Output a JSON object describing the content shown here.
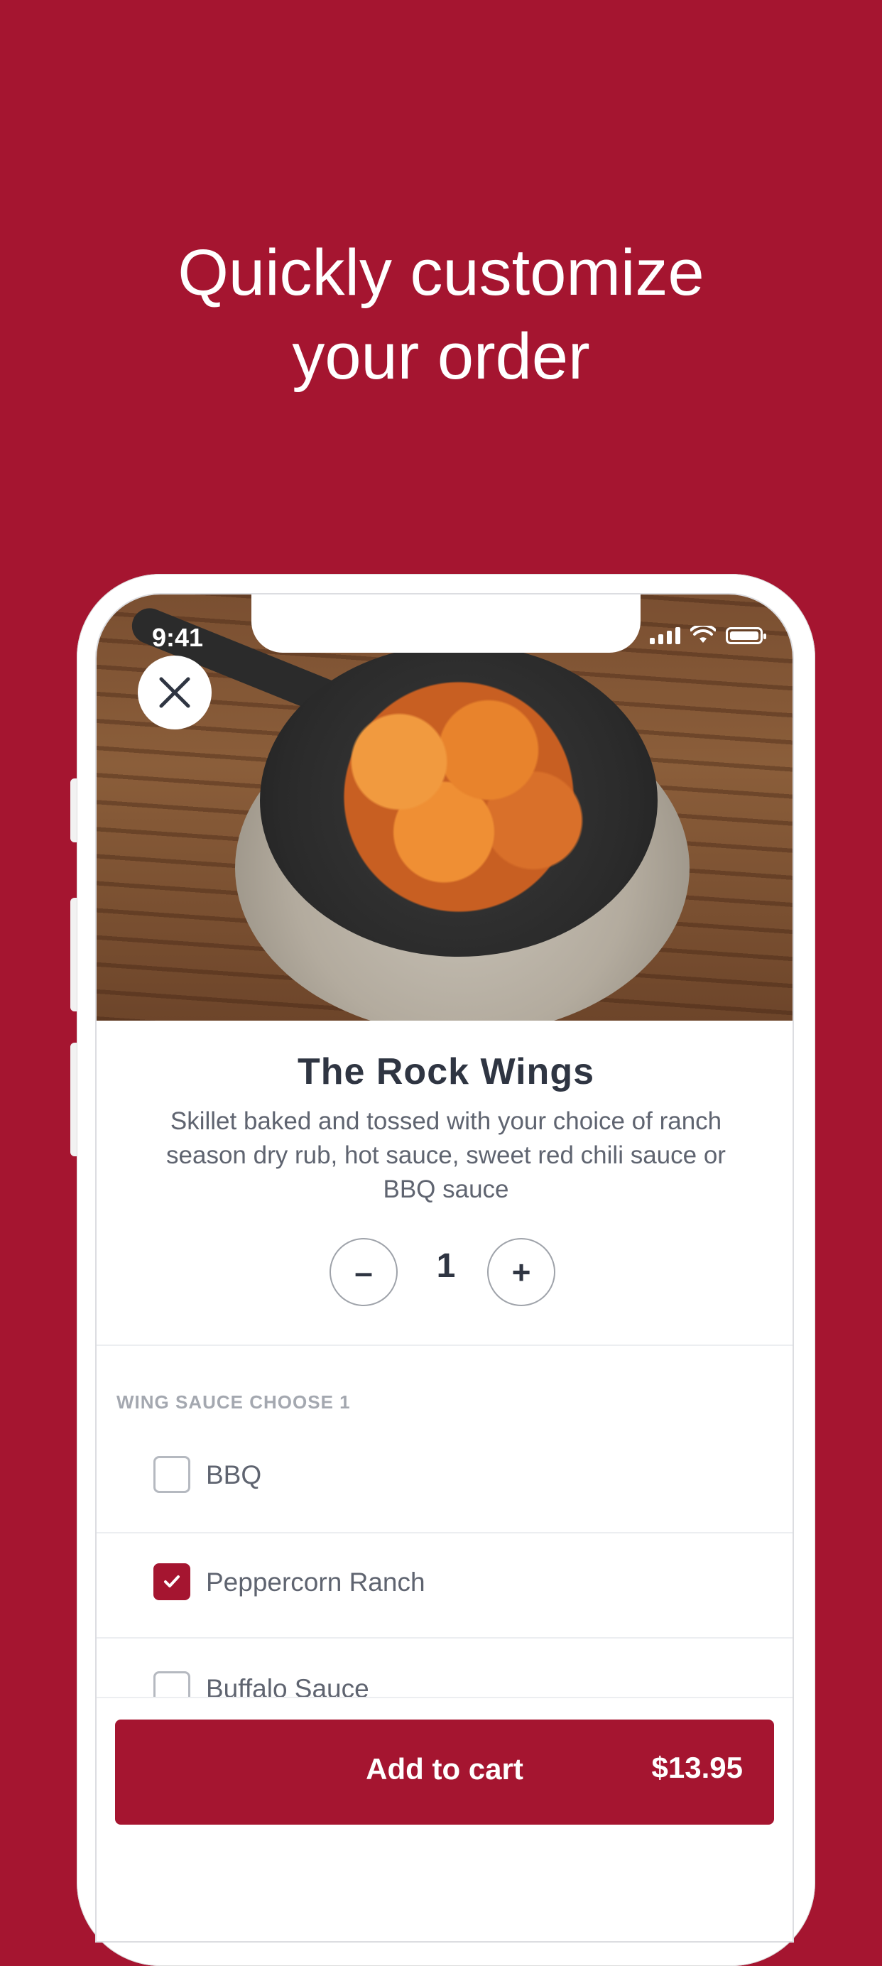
{
  "headline": {
    "line1": "Quickly customize",
    "line2": "your order"
  },
  "status_bar": {
    "time": "9:41",
    "icons": [
      "signal-icon",
      "wifi-icon",
      "battery-icon"
    ]
  },
  "item": {
    "name": "The Rock Wings",
    "description": "Skillet baked and tossed with your choice of ranch season dry rub, hot sauce, sweet red chili sauce or BBQ sauce",
    "quantity": "1",
    "minus_label": "–",
    "plus_label": "+"
  },
  "options_section": {
    "label": "WING SAUCE CHOOSE 1",
    "options": [
      {
        "label": "BBQ",
        "checked": false
      },
      {
        "label": "Peppercorn Ranch",
        "checked": true
      },
      {
        "label": "Buffalo Sauce",
        "checked": false
      }
    ]
  },
  "cart": {
    "label": "Add to cart",
    "price": "$13.95"
  },
  "colors": {
    "brand": "#a51530",
    "text_dark": "#2f3542",
    "text_muted": "#5f6470",
    "label_gray": "#a4a8b0"
  }
}
